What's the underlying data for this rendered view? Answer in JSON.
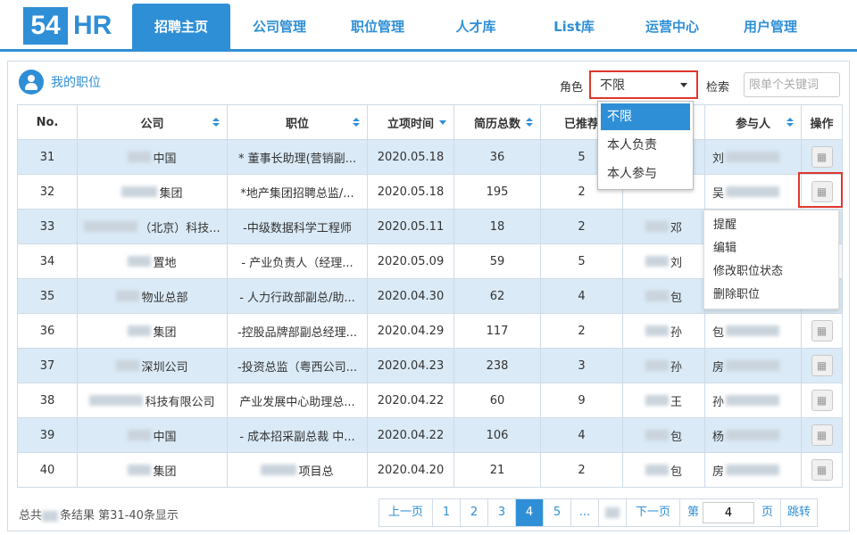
{
  "nav": {
    "logo_num": "54",
    "logo_text": "HR",
    "items": [
      "招聘主页",
      "公司管理",
      "职位管理",
      "人才库",
      "List库",
      "运营中心",
      "用户管理"
    ]
  },
  "panel": {
    "title": "我的职位",
    "role_label": "角色",
    "role_value": "不限",
    "role_options": [
      "不限",
      "本人负责",
      "本人参与"
    ],
    "search_label": "检索",
    "search_placeholder": "限单个关键词"
  },
  "table": {
    "headers": [
      "No.",
      "公司",
      "职位",
      "立项时间",
      "简历总数",
      "已推荐",
      "",
      "参与人",
      "操作"
    ],
    "rows": [
      {
        "no": "31",
        "company": "中国",
        "position": "* 董事长助理(营销副...",
        "date": "2020.05.18",
        "resumes": "36",
        "recommended": "5",
        "owner": "",
        "participant": "刘"
      },
      {
        "no": "32",
        "company": "集团",
        "position": "*地产集团招聘总监/...",
        "date": "2020.05.18",
        "resumes": "195",
        "recommended": "2",
        "owner": "",
        "participant": "吴"
      },
      {
        "no": "33",
        "company": "（北京）科技...",
        "position": "-中级数据科学工程师",
        "date": "2020.05.11",
        "resumes": "18",
        "recommended": "2",
        "owner": "邓",
        "participant": ""
      },
      {
        "no": "34",
        "company": "置地",
        "position": "- 产业负责人（经理...",
        "date": "2020.05.09",
        "resumes": "59",
        "recommended": "5",
        "owner": "刘",
        "participant": ""
      },
      {
        "no": "35",
        "company": "物业总部",
        "position": "- 人力行政部副总/助...",
        "date": "2020.04.30",
        "resumes": "62",
        "recommended": "4",
        "owner": "包",
        "participant": ""
      },
      {
        "no": "36",
        "company": "集团",
        "position": "-控股品牌部副总经理...",
        "date": "2020.04.29",
        "resumes": "117",
        "recommended": "2",
        "owner": "孙",
        "participant": "包"
      },
      {
        "no": "37",
        "company": "深圳公司",
        "position": "-投资总监（粤西公司...",
        "date": "2020.04.23",
        "resumes": "238",
        "recommended": "3",
        "owner": "孙",
        "participant": "房"
      },
      {
        "no": "38",
        "company": "科技有限公司",
        "position": "产业发展中心助理总...",
        "date": "2020.04.22",
        "resumes": "60",
        "recommended": "9",
        "owner": "王",
        "participant": "孙"
      },
      {
        "no": "39",
        "company": "中国",
        "position": "- 成本招采副总裁 中...",
        "date": "2020.04.22",
        "resumes": "106",
        "recommended": "4",
        "owner": "包",
        "participant": "杨"
      },
      {
        "no": "40",
        "company": "集团",
        "position": "项目总",
        "date": "2020.04.20",
        "resumes": "21",
        "recommended": "2",
        "owner": "包",
        "participant": "房"
      }
    ]
  },
  "context_menu": [
    "提醒",
    "编辑",
    "修改职位状态",
    "删除职位"
  ],
  "footer": {
    "summary_prefix": "总共",
    "summary_suffix": "条结果  第31-40条显示",
    "prev": "上一页",
    "pages": [
      "1",
      "2",
      "3",
      "4",
      "5",
      "..."
    ],
    "next": "下一页",
    "goto_prefix": "第",
    "goto_value": "4",
    "goto_suffix": "页",
    "jump": "跳转"
  },
  "colors": {
    "accent": "#2f8fd6",
    "row_alt": "#daeaf6",
    "highlight": "#e0362b"
  }
}
